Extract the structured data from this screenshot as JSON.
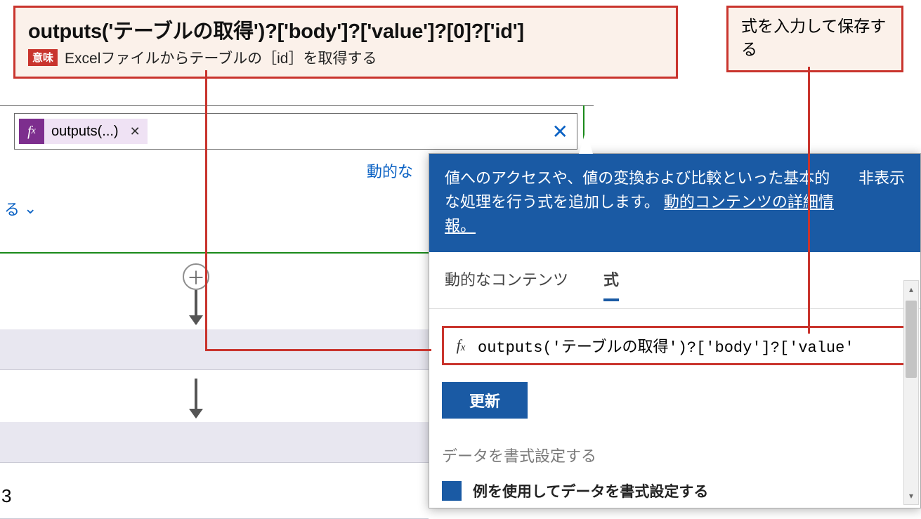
{
  "callout_expression": "outputs('テーブルの取得')?['body']?['value']?[0]?['id']",
  "callout_meaning_tag": "意味",
  "callout_meaning": "Excelファイルからテーブルの［id］を取得する",
  "callout_right": "式を入力して保存する",
  "field_chip_label": "outputs(...)",
  "truncated_dynamic_link": "動的な",
  "ru_text": "る",
  "row_number": "3",
  "panel": {
    "description": "値へのアクセスや、値の変換および比較といった基本的な処理を行う式を追加します。 ",
    "link": "動的コンテンツの詳細情報。",
    "hide": "非表示",
    "tab_dynamic": "動的なコンテンツ",
    "tab_expression": "式",
    "expression_input": "outputs('テーブルの取得')?['body']?['value'",
    "update_button": "更新",
    "section_format": "データを書式設定する",
    "example_line": "例を使用してデータを書式設定する"
  }
}
